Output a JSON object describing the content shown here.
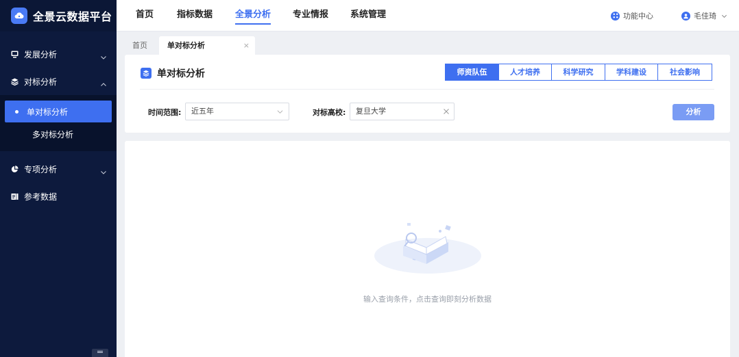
{
  "brand": {
    "title": "全景云数据平台",
    "logo_icon": "cloud-icon"
  },
  "sidebar": {
    "items": [
      {
        "label": "发展分析",
        "icon": "monitor-icon",
        "expanded": false
      },
      {
        "label": "对标分析",
        "icon": "layers-icon",
        "expanded": true,
        "children": [
          {
            "label": "单对标分析",
            "active": true
          },
          {
            "label": "多对标分析",
            "active": false
          }
        ]
      },
      {
        "label": "专项分析",
        "icon": "pie-icon",
        "expanded": false
      },
      {
        "label": "参考数据",
        "icon": "document-icon",
        "expanded": false
      }
    ]
  },
  "topnav": {
    "items": [
      "首页",
      "指标数据",
      "全景分析",
      "专业情报",
      "系统管理"
    ],
    "active": "全景分析",
    "function_center": "功能中心",
    "user_name": "毛佳琦"
  },
  "tabs": {
    "home": "首页",
    "current": "单对标分析",
    "close_glyph": "×"
  },
  "panel": {
    "title": "单对标分析",
    "segments": [
      "师资队伍",
      "人才培养",
      "科学研究",
      "学科建设",
      "社会影响"
    ],
    "active_segment": "师资队伍",
    "time_label": "时间范围:",
    "time_value": "近五年",
    "school_label": "对标高校:",
    "school_value": "复旦大学",
    "analyze_label": "分析"
  },
  "empty_state": {
    "message": "输入查询条件，点击查询即刻分析数据"
  },
  "colors": {
    "primary": "#3e6ff0",
    "sidebar_bg": "#0d1a3d",
    "page_bg": "#eef0f4"
  }
}
